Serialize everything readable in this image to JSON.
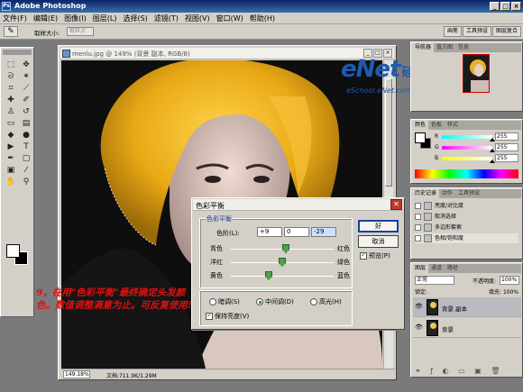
{
  "app": {
    "title": "Adobe Photoshop",
    "icon": "photoshop-app-icon"
  },
  "menu": [
    "文件(F)",
    "编辑(E)",
    "图像(I)",
    "图层(L)",
    "选择(S)",
    "滤镜(T)",
    "视图(V)",
    "窗口(W)",
    "帮助(H)"
  ],
  "options_bar": {
    "tool_icon": "eyedropper-icon",
    "label": "取样大小:",
    "sample_value": "取样点",
    "palette_tabs": [
      "画笔",
      "工具预设",
      "图层复合"
    ]
  },
  "document": {
    "title": "menlu.jpg @ 149% (背景 副本, RGB/8)",
    "zoom": "149.18%",
    "status": "文档:711.9K/1.29M"
  },
  "watermark": {
    "text": "eNet",
    "text_cn": "硅谷学",
    "url": "eSchool.eNet.com.cn"
  },
  "navigator": {
    "tabs": [
      "导航器",
      "直方图",
      "信息"
    ]
  },
  "color_palette": {
    "tabs": [
      "颜色",
      "色板",
      "样式"
    ],
    "rows": [
      {
        "label": "R",
        "value": "255",
        "pos": 1.0
      },
      {
        "label": "G",
        "value": "255",
        "pos": 1.0
      },
      {
        "label": "B",
        "value": "255",
        "pos": 1.0
      }
    ],
    "colors": {
      "foreground": "#ffffff",
      "background": "#000000"
    }
  },
  "history": {
    "tabs": [
      "历史记录",
      "动作",
      "工具预设"
    ],
    "items": [
      {
        "label": "亮度/对比度"
      },
      {
        "label": "取消选择"
      },
      {
        "label": "多边形套索"
      },
      {
        "label": "色相/饱和度"
      }
    ]
  },
  "layers": {
    "tabs": [
      "图层",
      "通道",
      "路径"
    ],
    "mode": "正常",
    "opacity_label": "不透明度:",
    "opacity": "100%",
    "lock_label": "锁定:",
    "fill_label": "填充:",
    "fill": "100%",
    "items": [
      {
        "name": "背景 副本",
        "selected": true
      },
      {
        "name": "背景",
        "selected": false
      }
    ]
  },
  "color_balance_dialog": {
    "title": "色彩平衡",
    "group_label": "色彩平衡",
    "levels_label": "色阶(L):",
    "levels": [
      "+9",
      "0",
      "-29"
    ],
    "sliders": [
      {
        "left": "青色",
        "right": "红色",
        "pos": 0.54
      },
      {
        "left": "洋红",
        "right": "绿色",
        "pos": 0.5
      },
      {
        "left": "黄色",
        "right": "蓝色",
        "pos": 0.37
      }
    ],
    "tone_label": "色调平衡",
    "tones": [
      {
        "label": "暗调(S)",
        "checked": false
      },
      {
        "label": "中间调(D)",
        "checked": true
      },
      {
        "label": "高光(H)",
        "checked": false
      }
    ],
    "preserve_luminosity": "保持亮度(V)",
    "ok": "好",
    "cancel": "取消",
    "preview": "预览(P)"
  },
  "caption": "9，在用\"色彩平衡\"最终确定头发颜色。数值调整满意为止。可反复使用!"
}
